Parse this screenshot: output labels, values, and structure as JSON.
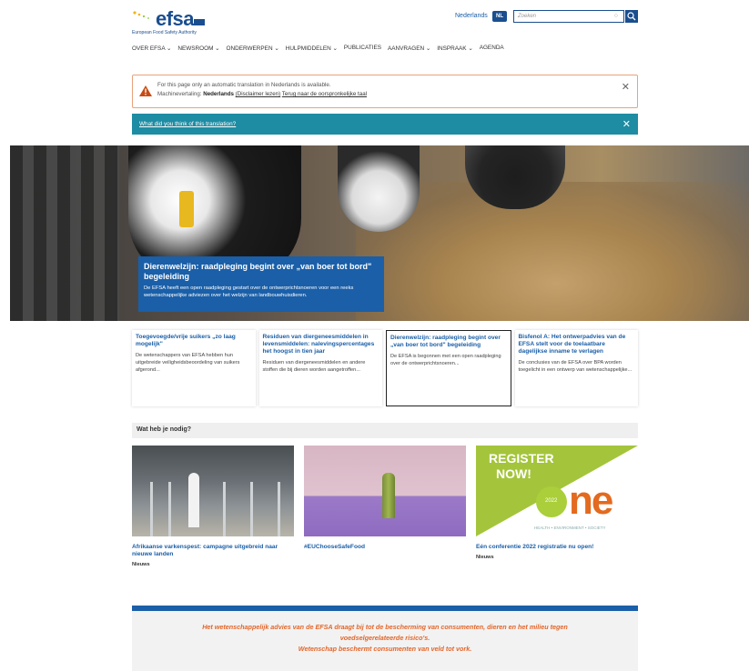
{
  "header": {
    "logo_text": "efsa",
    "logo_subtitle": "European Food Safety Authority",
    "language_link": "Nederlands",
    "language_code": "NL",
    "search_placeholder": "Zoeken"
  },
  "nav": [
    "OVER EFSA ⌄",
    "NEWSROOM ⌄",
    "ONDERWERPEN ⌄",
    "HULPMIDDELEN ⌄",
    "PUBLICATIES",
    "AANVRAGEN ⌄",
    "INSPRAAK ⌄",
    "AGENDA"
  ],
  "notice": {
    "line1": "For this page only an automatic translation in Nederlands is available.",
    "label": "Machinevertaling:",
    "language": "Nederlands",
    "disclaimer": "(Disclaimer lezen)",
    "back_link": "Terug naar de oorspronkelijke taal"
  },
  "feedback": {
    "link": "What did you think of this translation?"
  },
  "hero": {
    "title": "Dierenwelzijn: raadpleging begint over „van boer tot bord\" begeleiding",
    "text": "De EFSA heeft een open raadpleging gestart over de ontwerprichtsnoeren voor een reeks wetenschappelijke adviezen over het welzijn van landbouwhuisdieren."
  },
  "cards": [
    {
      "title": "Toegevoegde/vrije suikers „zo laag mogelijk\"",
      "text": "De wetenschappers van EFSA hebben hun uitgebreide veiligheidsbeoordeling van suikers afgerond..."
    },
    {
      "title": "Residuen van diergeneesmiddelen in levensmiddelen: nalevingspercentages het hoogst in tien jaar",
      "text": "Residuen van diergeneesmiddelen en andere stoffen die bij dieren worden aangetroffen..."
    },
    {
      "title": "Dierenwelzijn: raadpleging begint over „van boer tot bord\" begeleiding",
      "text": "De EFSA is begonnen met een open raadpleging over de ontwerprichtsnoeren..."
    },
    {
      "title": "Bisfenol A: Het ontwerpadvies van de EFSA stelt voor de toelaatbare dagelijkse inname te verlagen",
      "text": "De conclusies van de EFSA over BPA worden toegelicht in een ontwerp van wetenschappelijke..."
    }
  ],
  "section": {
    "title": "Wat heb je nodig?"
  },
  "tiles": [
    {
      "title": "Afrikaanse varkenspest: campagne uitgebreid naar nieuwe landen",
      "meta": "Nieuws"
    },
    {
      "title": "#EUChooseSafeFood",
      "meta": ""
    },
    {
      "title": "Eén conferentie 2022 registratie nu open!",
      "meta": "Nieuws"
    }
  ],
  "register_banner": {
    "line1": "REGISTER",
    "line2": "NOW!",
    "year": "2022",
    "brand": "ne",
    "tagline": "HEALTH • ENVIRONMENT • SOCIETY"
  },
  "footer": {
    "line1": "Het wetenschappelijk advies van de EFSA draagt bij tot de bescherming van consumenten, dieren en het milieu tegen",
    "line2": "voedselgerelateerde risico's.",
    "line3": "Wetenschap beschermt consumenten van veld tot vork."
  },
  "colors": {
    "brand_blue": "#1a4e8f",
    "link_blue": "#1a5fa8",
    "teal": "#1e8ca3",
    "warning_orange": "#e8a37a",
    "footer_orange": "#e3662a"
  }
}
